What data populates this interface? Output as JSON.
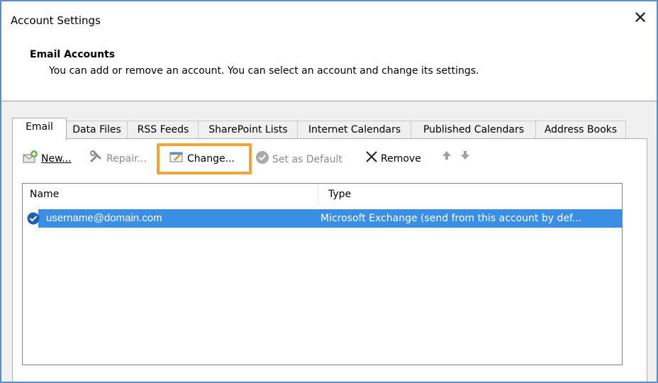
{
  "window": {
    "title": "Account Settings",
    "close_glyph": "✕"
  },
  "header": {
    "heading": "Email Accounts",
    "description": "You can add or remove an account. You can select an account and change its settings."
  },
  "tabs": [
    {
      "label": "Email",
      "active": true
    },
    {
      "label": "Data Files"
    },
    {
      "label": "RSS Feeds"
    },
    {
      "label": "SharePoint Lists"
    },
    {
      "label": "Internet Calendars"
    },
    {
      "label": "Published Calendars"
    },
    {
      "label": "Address Books"
    }
  ],
  "toolbar": {
    "new_label": "New...",
    "repair_label": "Repair...",
    "change_label": "Change...",
    "set_default_label": "Set as Default",
    "remove_label": "Remove",
    "highlight_color": "#f0a437"
  },
  "list": {
    "columns": [
      "Name",
      "Type"
    ],
    "rows": [
      {
        "name": "username@domain.com",
        "type": "Microsoft Exchange (send from this account by def..."
      }
    ],
    "selection_color": "#3a8fe5"
  }
}
